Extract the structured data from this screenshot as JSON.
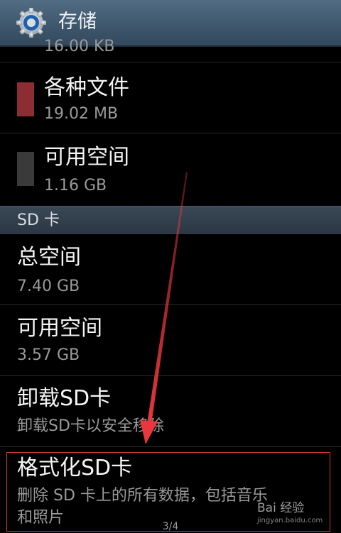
{
  "header": {
    "title": "存储",
    "icon": "settings-gear-icon"
  },
  "storage": {
    "partial_value": "16.00 KB",
    "items": [
      {
        "label": "各种文件",
        "value": "19.02 MB",
        "color": "#8b2d32"
      },
      {
        "label": "可用空间",
        "value": "1.16 GB",
        "color": "#3a3a3a"
      }
    ]
  },
  "sd_card": {
    "section_title": "SD 卡",
    "total_label": "总空间",
    "total_value": "7.40 GB",
    "free_label": "可用空间",
    "free_value": "3.57 GB",
    "unmount_label": "卸载SD卡",
    "unmount_desc": "卸载SD卡以安全移除",
    "format_label": "格式化SD卡",
    "format_desc_line1": "删除 SD 卡上的所有数据，包括音乐",
    "format_desc_line2": "和照片"
  },
  "page_indicator": "3/4",
  "watermark": {
    "text": "Bai 经验",
    "sub": "jingyan.baidu.com"
  },
  "colors": {
    "annotation_red": "#e8383d",
    "header_blue": "#3d566c"
  }
}
